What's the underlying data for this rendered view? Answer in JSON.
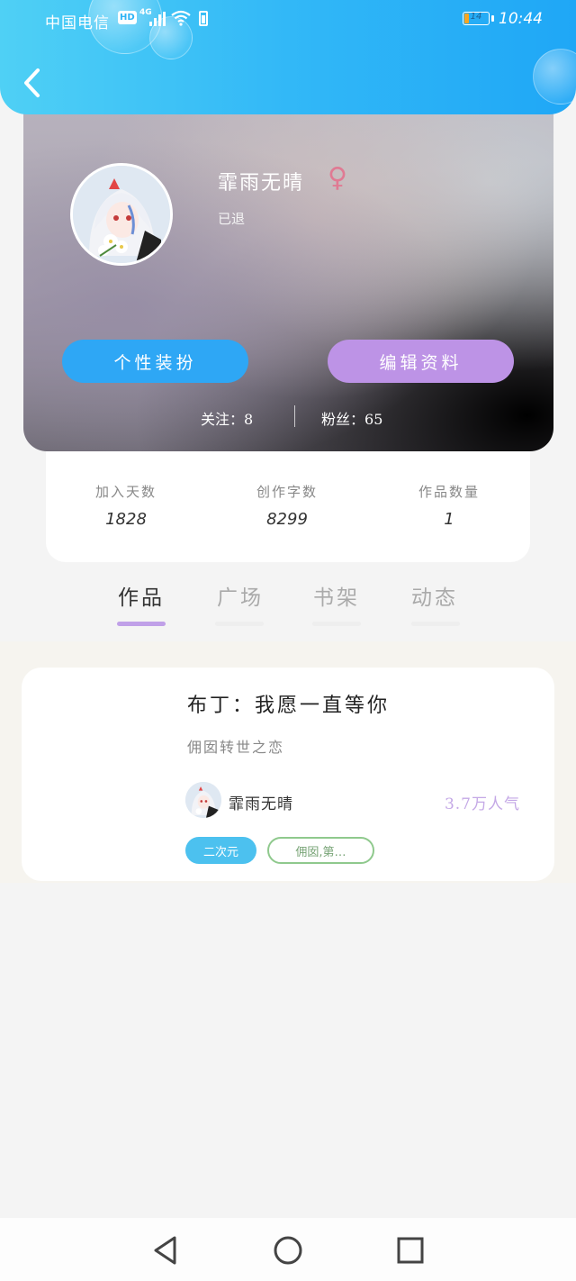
{
  "status_bar": {
    "carrier": "中国电信",
    "hd": "HD",
    "network": "4G",
    "battery_level": "14",
    "time": "10:44"
  },
  "header": {
    "back_icon": "chevron-left-icon"
  },
  "profile": {
    "username": "霏雨无晴",
    "gender_symbol": "♀",
    "status": "已退",
    "buttons": {
      "customize": "个性装扮",
      "edit_profile": "编辑资料"
    },
    "follow": {
      "following_label": "关注：",
      "following_count": "8",
      "fans_label": "粉丝：",
      "fans_count": "65"
    },
    "colors": {
      "customize_button": "#2ea7f5",
      "edit_button": "#bd93e6",
      "gender": "#e07a93"
    }
  },
  "stats": [
    {
      "label": "加入天数",
      "value": "1828"
    },
    {
      "label": "创作字数",
      "value": "8299"
    },
    {
      "label": "作品数量",
      "value": "1"
    }
  ],
  "tabs": [
    {
      "label": "作品",
      "active": true
    },
    {
      "label": "广场",
      "active": false
    },
    {
      "label": "书架",
      "active": false
    },
    {
      "label": "动态",
      "active": false
    }
  ],
  "works": [
    {
      "title": "布丁：我愿一直等你",
      "description": "佣囡转世之恋",
      "author": "霏雨无晴",
      "popularity": "3.7万人气",
      "tags": [
        "二次元",
        "佣囡,第…"
      ]
    }
  ],
  "navbar": [
    "back-triangle-icon",
    "home-circle-icon",
    "recents-square-icon"
  ]
}
